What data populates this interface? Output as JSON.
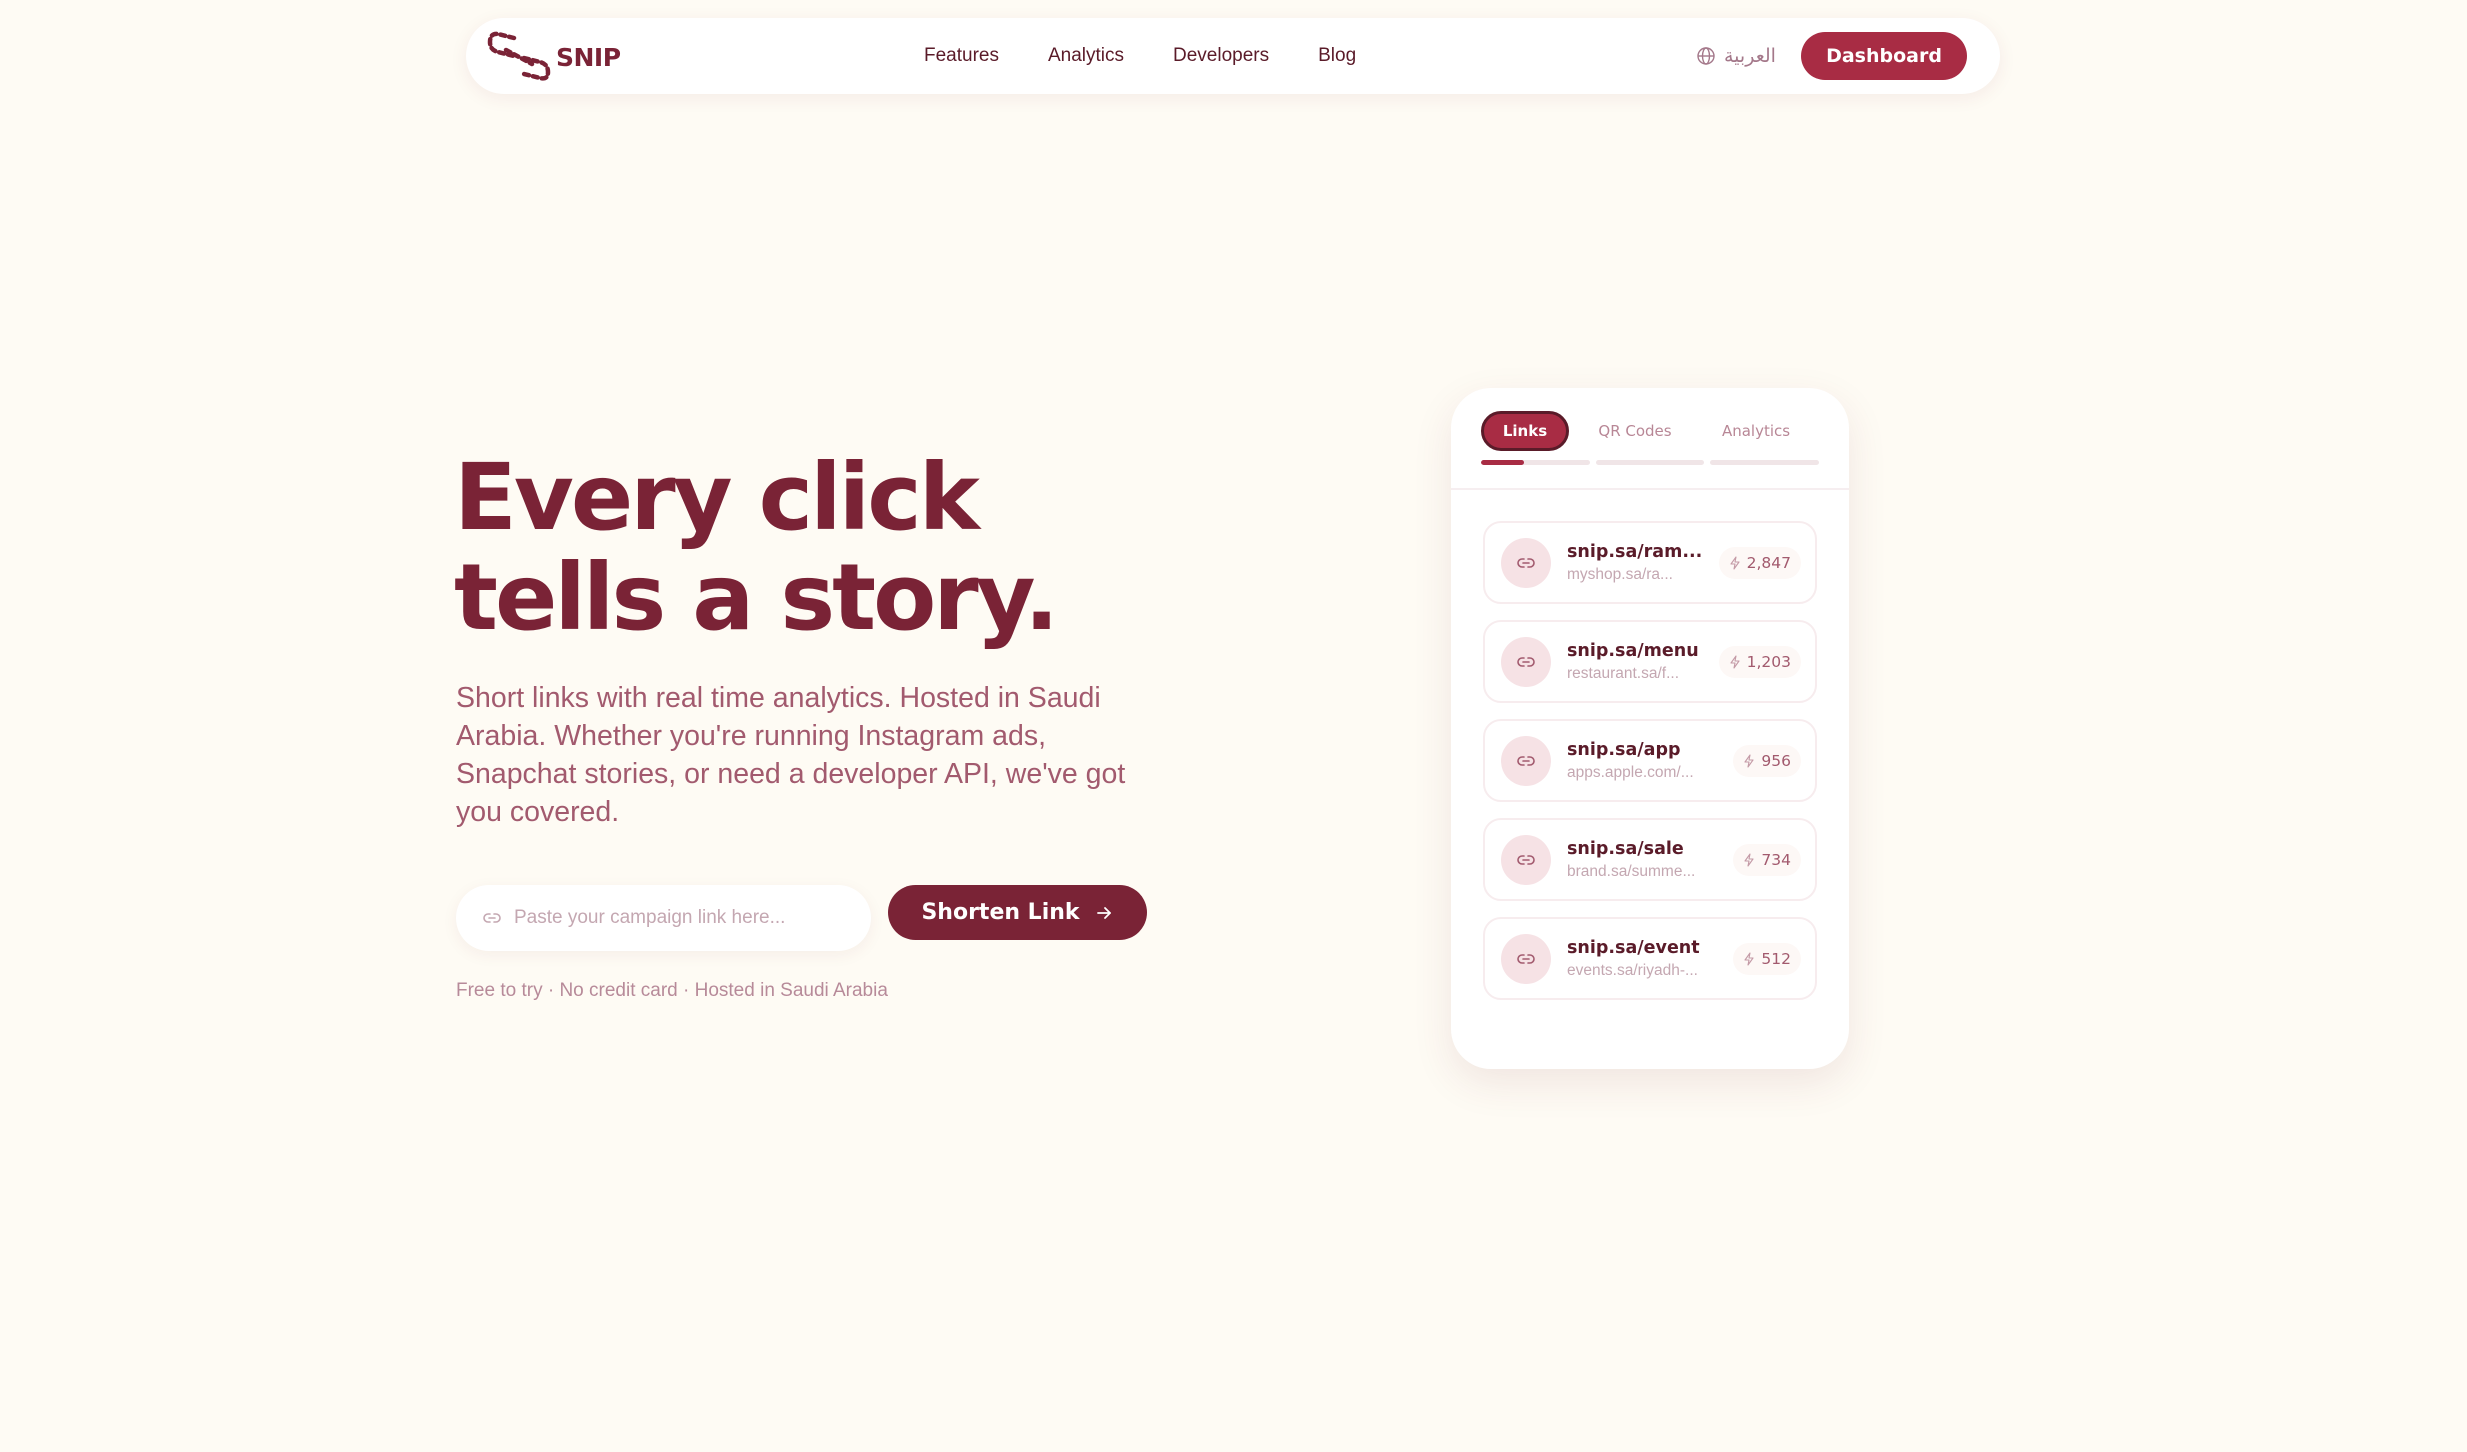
{
  "brand": {
    "name": "SNIP",
    "primary": "#a82c44",
    "dark": "#7a2336",
    "background": "#fefbf4"
  },
  "nav": {
    "links": [
      "Features",
      "Analytics",
      "Developers",
      "Blog"
    ],
    "language_label": "العربية",
    "dashboard_label": "Dashboard"
  },
  "hero": {
    "title_line1": "Every click",
    "title_line2": "tells a story.",
    "description": "Short links with real time analytics. Hosted in Saudi Arabia. Whether you're running Instagram ads, Snapchat stories, or need a developer API, we've got you covered.",
    "input_placeholder": "Paste your campaign link here...",
    "input_value": "",
    "cta_label": "Shorten Link",
    "note": "Free to try · No credit card · Hosted in Saudi Arabia"
  },
  "preview": {
    "tabs": [
      "Links",
      "QR Codes",
      "Analytics"
    ],
    "active_tab": 0,
    "progress": [
      0.4,
      0,
      0
    ],
    "links": [
      {
        "short": "snip.sa/ram...",
        "dest": "myshop.sa/ra...",
        "clicks": "2,847"
      },
      {
        "short": "snip.sa/menu",
        "dest": "restaurant.sa/f...",
        "clicks": "1,203"
      },
      {
        "short": "snip.sa/app",
        "dest": "apps.apple.com/...",
        "clicks": "956"
      },
      {
        "short": "snip.sa/sale",
        "dest": "brand.sa/summe...",
        "clicks": "734"
      },
      {
        "short": "snip.sa/event",
        "dest": "events.sa/riyadh-...",
        "clicks": "512"
      }
    ]
  },
  "icons": {
    "logo": "chain-link-logo-icon",
    "language": "globe-icon",
    "input": "link-icon",
    "cta": "arrow-right-icon",
    "link_item": "link-icon",
    "clicks": "bolt-icon"
  }
}
